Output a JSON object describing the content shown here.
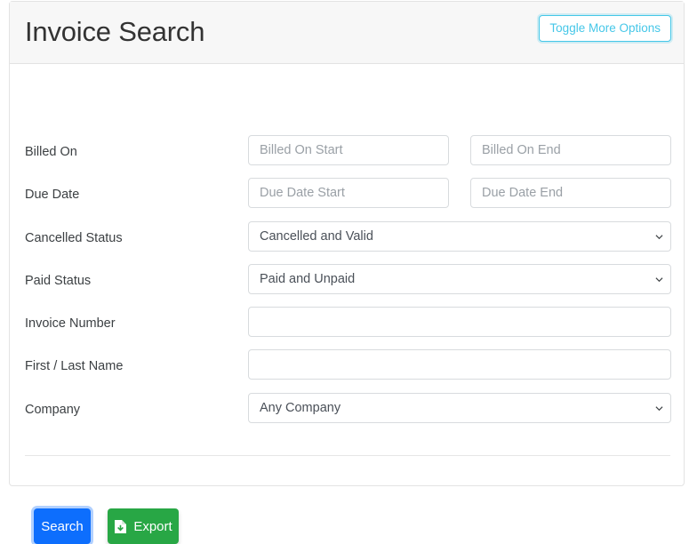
{
  "header": {
    "title": "Invoice Search",
    "toggle_label": "Toggle More Options"
  },
  "colors": {
    "accent_cyan": "#46c7e8",
    "search_blue": "#0d6efd",
    "export_green": "#28a745",
    "header_bg": "#f7f7f7",
    "border": "#e3e3e3",
    "label_text": "#3c4043",
    "placeholder": "#9aa0a6"
  },
  "form": {
    "rows": [
      {
        "label": "Billed On",
        "type": "date-range",
        "start": {
          "name": "billed-on-start",
          "placeholder": "Billed On Start",
          "value": ""
        },
        "end": {
          "name": "billed-on-end",
          "placeholder": "Billed On End",
          "value": ""
        }
      },
      {
        "label": "Due Date",
        "type": "date-range",
        "start": {
          "name": "due-date-start",
          "placeholder": "Due Date Start",
          "value": ""
        },
        "end": {
          "name": "due-date-end",
          "placeholder": "Due Date End",
          "value": ""
        }
      },
      {
        "label": "Cancelled Status",
        "type": "select",
        "field": {
          "name": "cancelled-status",
          "value": "Cancelled and Valid"
        }
      },
      {
        "label": "Paid Status",
        "type": "select",
        "field": {
          "name": "paid-status",
          "value": "Paid and Unpaid"
        }
      },
      {
        "label": "Invoice Number",
        "type": "text",
        "field": {
          "name": "invoice-number",
          "placeholder": "",
          "value": ""
        }
      },
      {
        "label": "First / Last Name",
        "type": "text",
        "field": {
          "name": "first-last-name",
          "placeholder": "",
          "value": ""
        }
      },
      {
        "label": "Company",
        "type": "select",
        "field": {
          "name": "company",
          "value": "Any Company"
        }
      }
    ]
  },
  "footer": {
    "search_label": "Search",
    "export_label": "Export",
    "export_icon": "file-export-icon"
  }
}
